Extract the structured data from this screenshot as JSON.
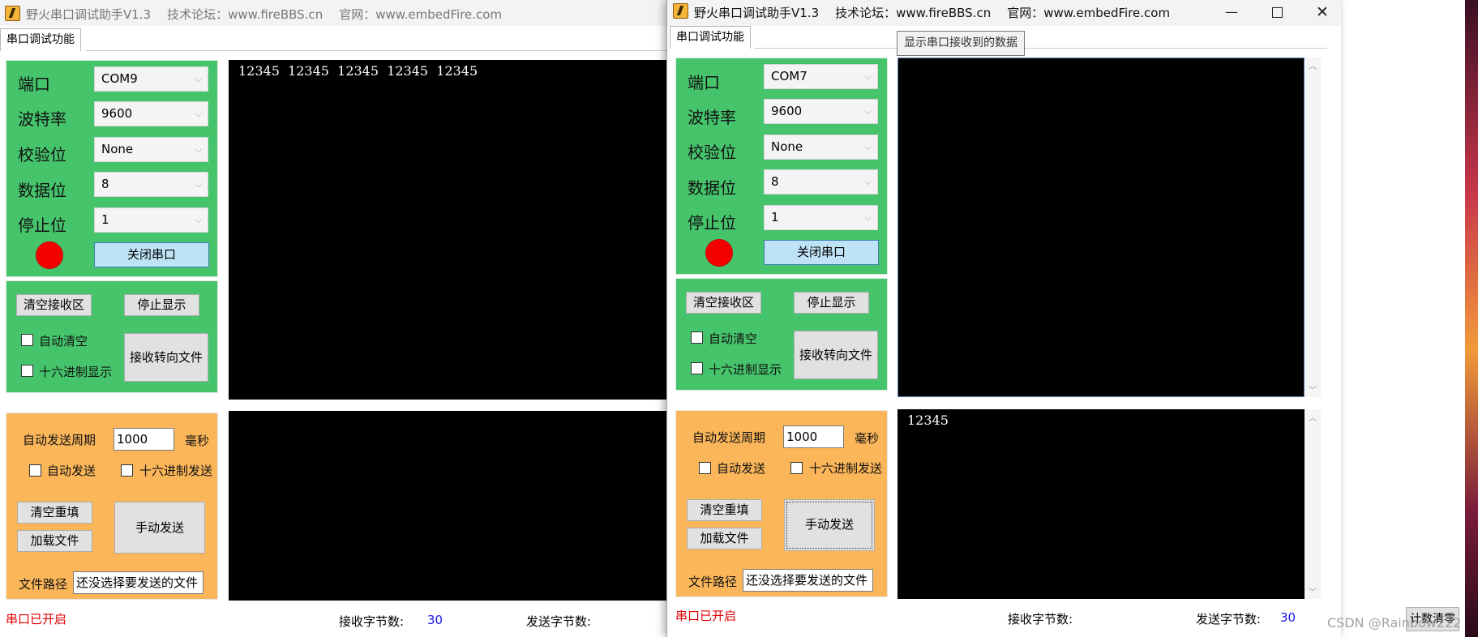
{
  "left": {
    "title": "野火串口调试助手V1.3",
    "forum": "技术论坛：www.fireBBS.cn",
    "site": "官网：www.embedFire.com",
    "tab": "串口调试功能",
    "port_label": "端口",
    "port_value": "COM9",
    "baud_label": "波特率",
    "baud_value": "9600",
    "parity_label": "校验位",
    "parity_value": "None",
    "databits_label": "数据位",
    "databits_value": "8",
    "stopbits_label": "停止位",
    "stopbits_value": "1",
    "close_port": "关闭串口",
    "clear_rx": "清空接收区",
    "stop_display": "停止显示",
    "auto_clear": "自动清空",
    "hex_display": "十六进制显示",
    "rx_to_file": "接收转向文件",
    "auto_send_period": "自动发送周期",
    "period_value": "1000",
    "ms": "毫秒",
    "auto_send": "自动发送",
    "hex_send": "十六进制发送",
    "clear_refill": "清空重填",
    "load_file": "加载文件",
    "manual_send": "手动发送",
    "file_path": "文件路径",
    "file_path_value": "还没选择要发送的文件",
    "rx_text": "12345  12345  12345  12345  12345",
    "tx_text": "",
    "status": "串口已开启",
    "rx_count_label": "接收字节数:",
    "rx_count": "30",
    "tx_count_label": "发送字节数:"
  },
  "right": {
    "title": "野火串口调试助手V1.3",
    "forum": "技术论坛：www.fireBBS.cn",
    "site": "官网：www.embedFire.com",
    "tab": "串口调试功能",
    "tooltip": "显示串口接收到的数据",
    "port_label": "端口",
    "port_value": "COM7",
    "baud_label": "波特率",
    "baud_value": "9600",
    "parity_label": "校验位",
    "parity_value": "None",
    "databits_label": "数据位",
    "databits_value": "8",
    "stopbits_label": "停止位",
    "stopbits_value": "1",
    "close_port": "关闭串口",
    "clear_rx": "清空接收区",
    "stop_display": "停止显示",
    "auto_clear": "自动清空",
    "hex_display": "十六进制显示",
    "rx_to_file": "接收转向文件",
    "auto_send_period": "自动发送周期",
    "period_value": "1000",
    "ms": "毫秒",
    "auto_send": "自动发送",
    "hex_send": "十六进制发送",
    "clear_refill": "清空重填",
    "load_file": "加载文件",
    "manual_send": "手动发送",
    "file_path": "文件路径",
    "file_path_value": "还没选择要发送的文件",
    "rx_text": "",
    "tx_text": "12345",
    "status": "串口已开启",
    "rx_count_label": "接收字节数:",
    "tx_count_label": "发送字节数:",
    "tx_count": "30",
    "clear_count": "计数清零"
  },
  "watermark": "CSDN @Rainbow222",
  "colors": {
    "config_panel": "#46c46c",
    "send_panel": "#fbb65a",
    "led": "#f40000",
    "status_text": "#e00000",
    "count_text": "#1717e8",
    "terminal": "#000000"
  },
  "icons": {
    "app": "lightning-app-icon",
    "combo": "chevron-down-icon",
    "minimize": "minimize-icon",
    "maximize": "maximize-icon",
    "close": "close-icon"
  }
}
